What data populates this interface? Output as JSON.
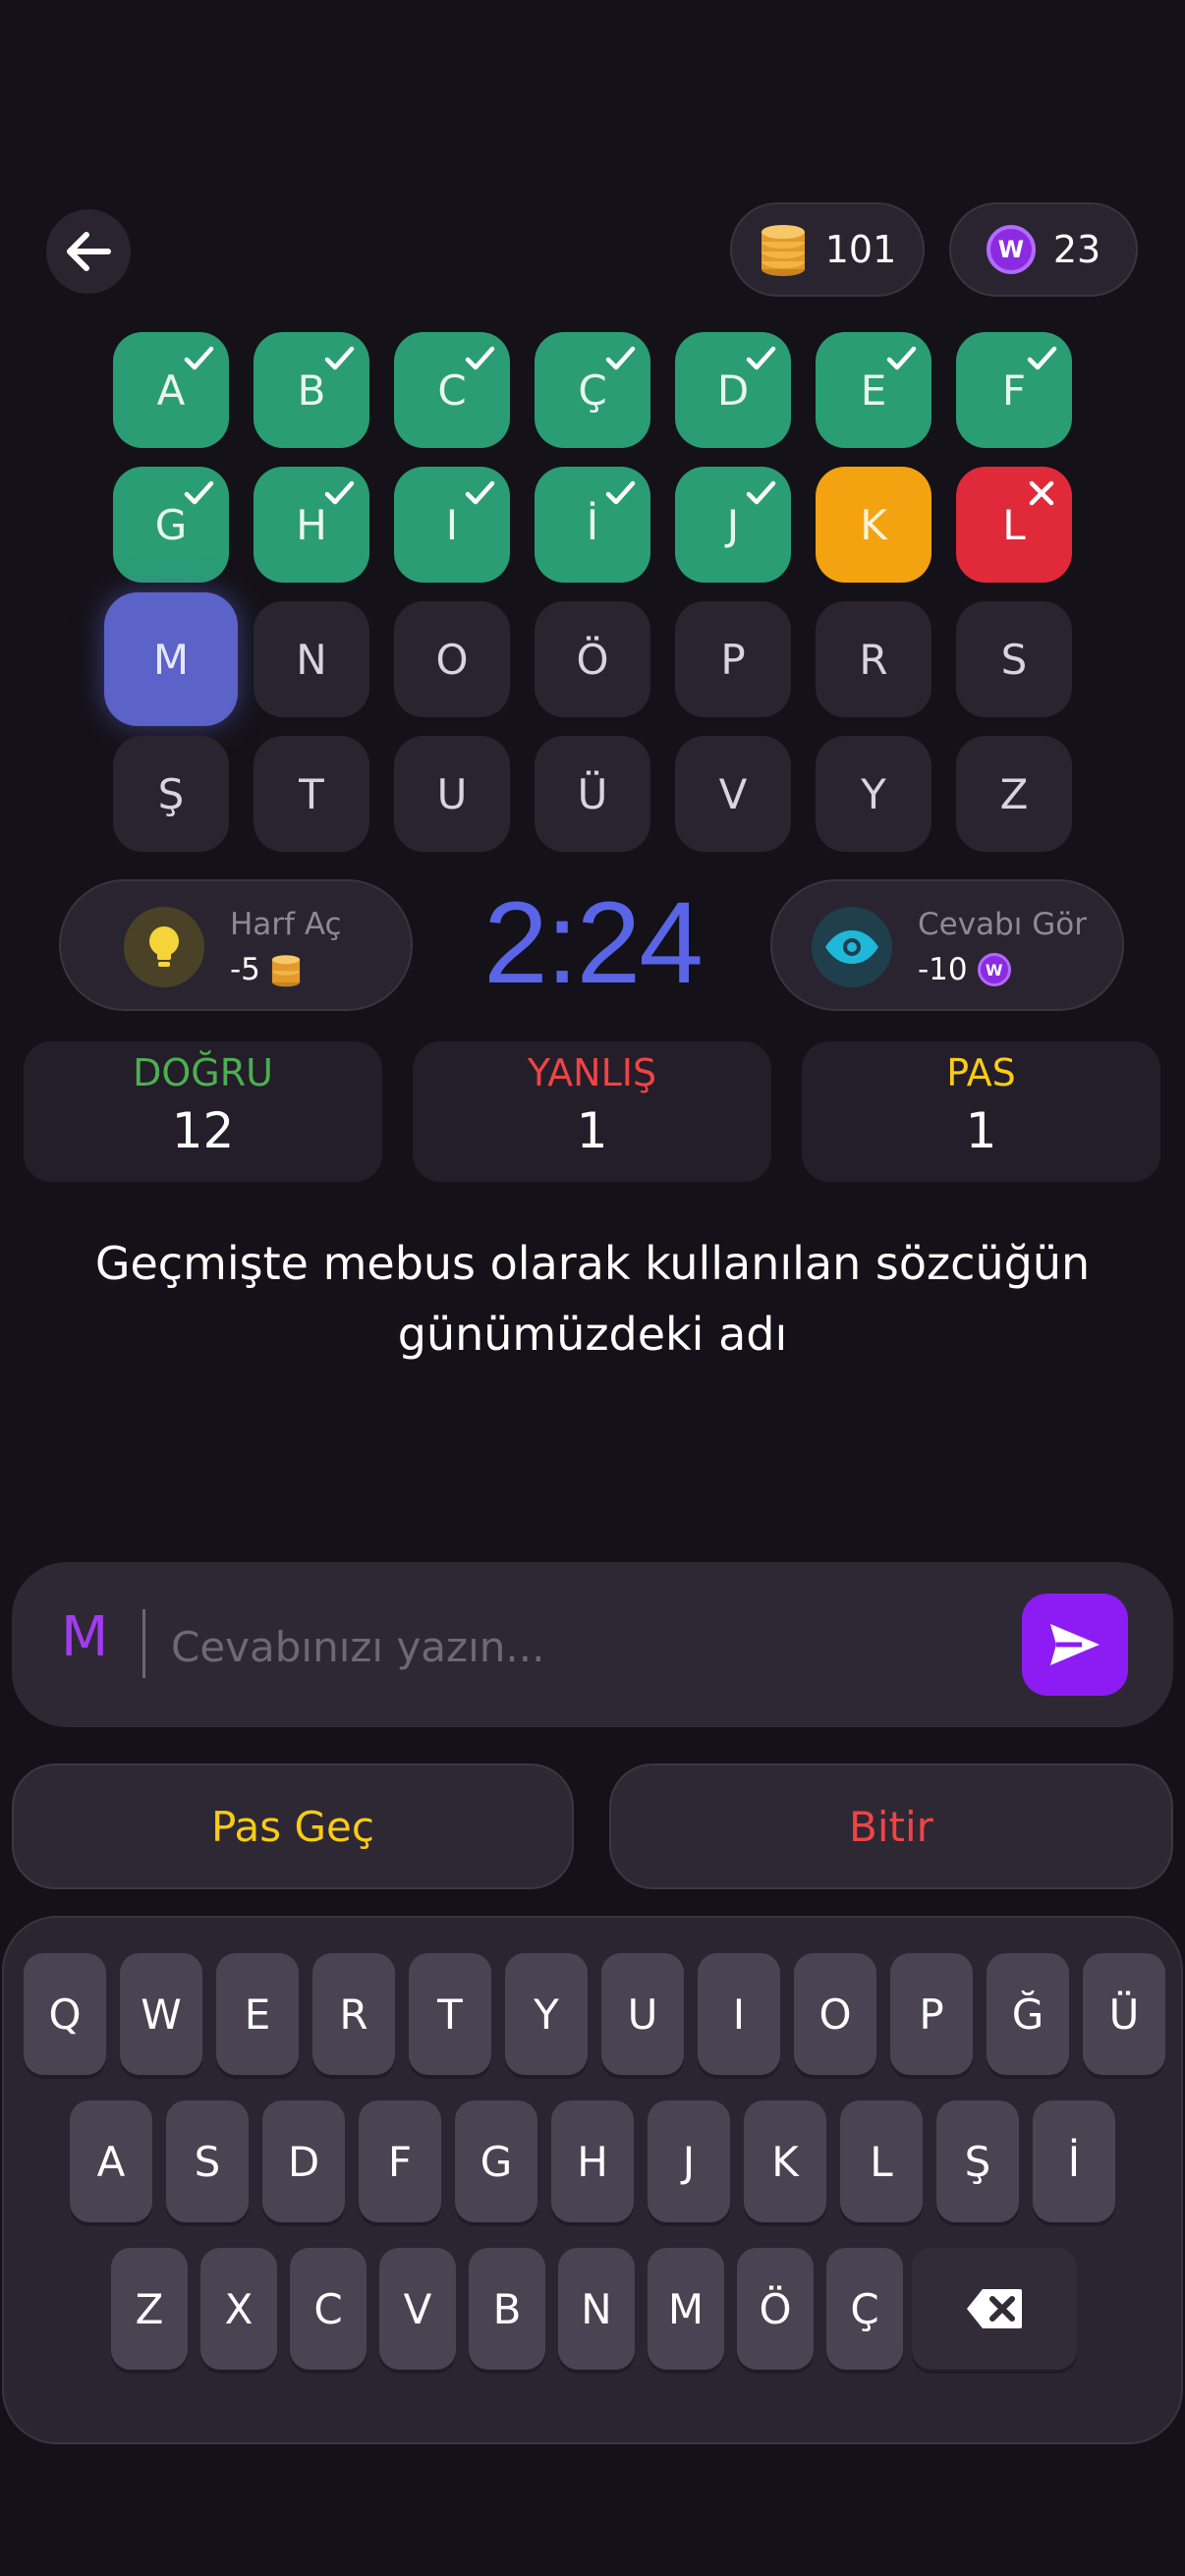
{
  "header": {
    "coins": "101",
    "wcoin_symbol": "W",
    "wcoins": "23"
  },
  "letters": [
    {
      "char": "A",
      "state": "correct"
    },
    {
      "char": "B",
      "state": "correct"
    },
    {
      "char": "C",
      "state": "correct"
    },
    {
      "char": "Ç",
      "state": "correct"
    },
    {
      "char": "D",
      "state": "correct"
    },
    {
      "char": "E",
      "state": "correct"
    },
    {
      "char": "F",
      "state": "correct"
    },
    {
      "char": "G",
      "state": "correct"
    },
    {
      "char": "H",
      "state": "correct"
    },
    {
      "char": "I",
      "state": "correct"
    },
    {
      "char": "İ",
      "state": "correct"
    },
    {
      "char": "J",
      "state": "correct"
    },
    {
      "char": "K",
      "state": "passed"
    },
    {
      "char": "L",
      "state": "wrong"
    },
    {
      "char": "M",
      "state": "current"
    },
    {
      "char": "N",
      "state": "pending"
    },
    {
      "char": "O",
      "state": "pending"
    },
    {
      "char": "Ö",
      "state": "pending"
    },
    {
      "char": "P",
      "state": "pending"
    },
    {
      "char": "R",
      "state": "pending"
    },
    {
      "char": "S",
      "state": "pending"
    },
    {
      "char": "Ş",
      "state": "pending"
    },
    {
      "char": "T",
      "state": "pending"
    },
    {
      "char": "U",
      "state": "pending"
    },
    {
      "char": "Ü",
      "state": "pending"
    },
    {
      "char": "V",
      "state": "pending"
    },
    {
      "char": "Y",
      "state": "pending"
    },
    {
      "char": "Z",
      "state": "pending"
    }
  ],
  "helpers": {
    "reveal_letter": {
      "title": "Harf Aç",
      "cost": "-5",
      "icon": "lightbulb-icon"
    },
    "show_answer": {
      "title": "Cevabı Gör",
      "cost": "-10",
      "icon": "eye-icon"
    }
  },
  "timer": "2:24",
  "stats": {
    "correct": {
      "label": "DOĞRU",
      "value": "12",
      "color": "#4caf50"
    },
    "wrong": {
      "label": "YANLIŞ",
      "value": "1",
      "color": "#ef4444"
    },
    "pass": {
      "label": "PAS",
      "value": "1",
      "color": "#facc15"
    }
  },
  "question": "Geçmişte mebus olarak kullanılan sözcüğün günümüzdeki adı",
  "answer_input": {
    "prefix": "M",
    "value": "",
    "placeholder": "Cevabınızı yazın..."
  },
  "actions": {
    "pass_label": "Pas Geç",
    "finish_label": "Bitir"
  },
  "keyboard": {
    "row1": [
      "Q",
      "W",
      "E",
      "R",
      "T",
      "Y",
      "U",
      "I",
      "O",
      "P",
      "Ğ",
      "Ü"
    ],
    "row2": [
      "A",
      "S",
      "D",
      "F",
      "G",
      "H",
      "J",
      "K",
      "L",
      "Ş",
      "İ"
    ],
    "row3": [
      "Z",
      "X",
      "C",
      "V",
      "B",
      "N",
      "M",
      "Ö",
      "Ç"
    ]
  },
  "colors": {
    "background": "#141118",
    "correct_tile": "#2a9d74",
    "passed_tile": "#f2a30f",
    "wrong_tile": "#e02a3a",
    "current_tile": "#5b62c8",
    "timer": "#5965e6",
    "accent_purple": "#8c1cf3"
  }
}
